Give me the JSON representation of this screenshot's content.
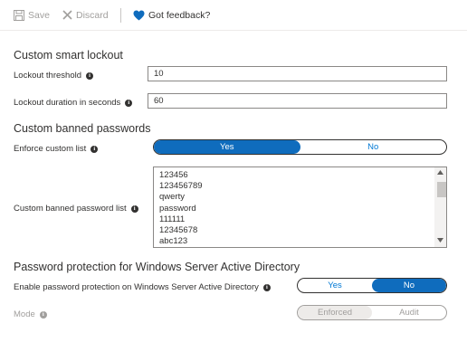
{
  "toolbar": {
    "save_label": "Save",
    "discard_label": "Discard",
    "feedback_label": "Got feedback?"
  },
  "smart_lockout": {
    "heading": "Custom smart lockout",
    "threshold_label": "Lockout threshold",
    "threshold_value": "10",
    "duration_label": "Lockout duration in seconds",
    "duration_value": "60"
  },
  "banned_passwords": {
    "heading": "Custom banned passwords",
    "enforce_label": "Enforce custom list",
    "enforce_yes": "Yes",
    "enforce_no": "No",
    "enforce_selected": "Yes",
    "list_label": "Custom banned password list",
    "list_items": [
      "123456",
      "123456789",
      "qwerty",
      "password",
      "111111",
      "12345678",
      "abc123"
    ]
  },
  "windows_ad": {
    "heading": "Password protection for Windows Server Active Directory",
    "enable_label": "Enable password protection on Windows Server Active Directory",
    "enable_yes": "Yes",
    "enable_no": "No",
    "enable_selected": "No",
    "mode_label": "Mode",
    "mode_enforced": "Enforced",
    "mode_audit": "Audit",
    "mode_selected": "Enforced"
  },
  "colors": {
    "accent": "#0f6cbd",
    "heart": "#0f6cbd",
    "disabled_text": "#a19f9d"
  }
}
